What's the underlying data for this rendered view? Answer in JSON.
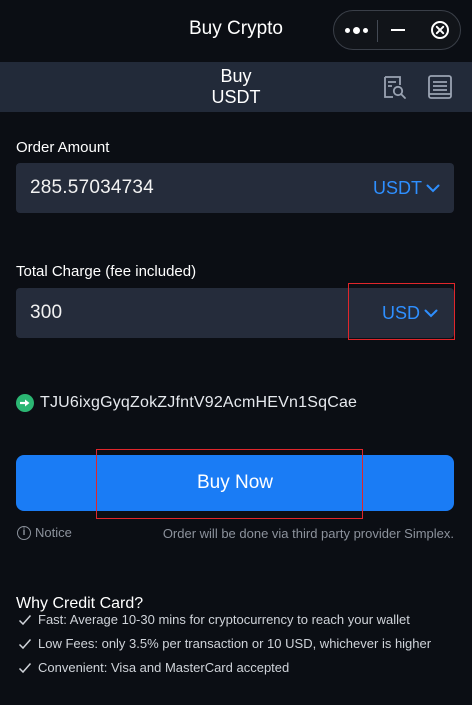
{
  "window": {
    "title": "Buy Crypto"
  },
  "subheader": {
    "title_line1": "Buy",
    "title_line2": "USDT",
    "icons": [
      "order-search-icon",
      "receipt-list-icon"
    ]
  },
  "order_amount": {
    "label": "Order Amount",
    "value": "285.57034734",
    "currency": "USDT"
  },
  "total_charge": {
    "label": "Total Charge (fee included)",
    "value": "300",
    "currency": "USD"
  },
  "wallet": {
    "address": "TJU6ixgGyqZokZJfntV92AcmHEVn1SqCae"
  },
  "actions": {
    "buy_label": "Buy Now"
  },
  "notice": {
    "label": "Notice",
    "provider_text": "Order will be done via third party provider Simplex."
  },
  "why": {
    "title": "Why Credit Card?",
    "items": [
      "Fast: Average 10-30 mins for cryptocurrency to reach your wallet",
      "Low Fees: only 3.5% per transaction or 10 USD, whichever is higher",
      "Convenient: Visa and MasterCard accepted"
    ]
  },
  "colors": {
    "background": "#0b0e14",
    "field": "#252c3b",
    "accent": "#1a7cf5",
    "currency": "#2e8fff",
    "highlight": "#e0262b",
    "address_icon": "#2bb673"
  }
}
